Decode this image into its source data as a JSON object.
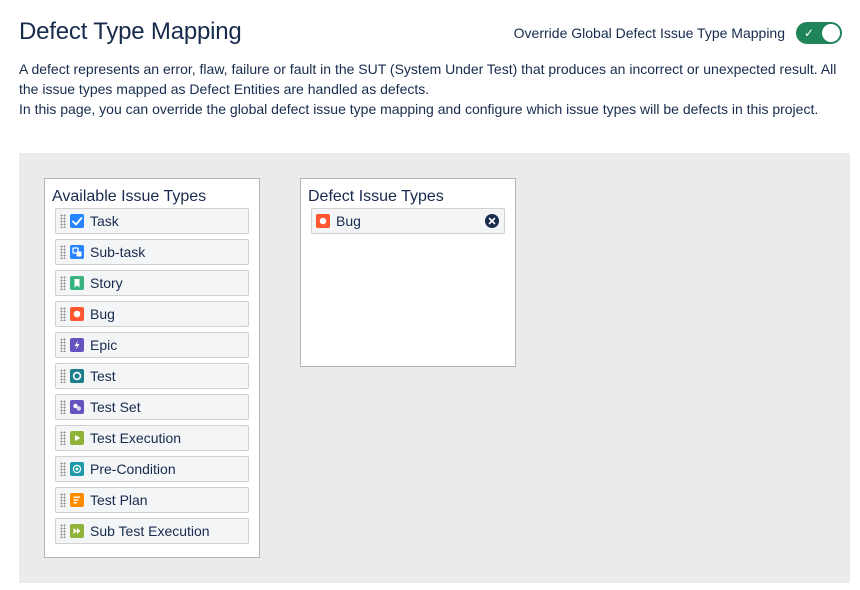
{
  "page": {
    "title": "Defect Type Mapping",
    "override_label": "Override Global Defect Issue Type Mapping",
    "override_enabled": true,
    "description_line1": "A defect represents an error, flaw, failure or fault in the SUT (System Under Test) that produces an incorrect or unexpected result. All the issue types mapped as Defect Entities are handled as defects.",
    "description_line2": "In this page, you can override the global defect issue type mapping and configure which issue types will be defects in this project."
  },
  "available": {
    "title": "Available Issue Types",
    "items": [
      {
        "label": "Task",
        "icon": "task-icon",
        "color": "#2684ff"
      },
      {
        "label": "Sub-task",
        "icon": "subtask-icon",
        "color": "#2684ff"
      },
      {
        "label": "Story",
        "icon": "story-icon",
        "color": "#36b37e"
      },
      {
        "label": "Bug",
        "icon": "bug-icon",
        "color": "#ff5630"
      },
      {
        "label": "Epic",
        "icon": "epic-icon",
        "color": "#6554c0"
      },
      {
        "label": "Test",
        "icon": "test-icon",
        "color": "#1d7f8c"
      },
      {
        "label": "Test Set",
        "icon": "test-set-icon",
        "color": "#6554c0"
      },
      {
        "label": "Test Execution",
        "icon": "test-execution-icon",
        "color": "#8fb339"
      },
      {
        "label": "Pre-Condition",
        "icon": "pre-condition-icon",
        "color": "#1d9aaa"
      },
      {
        "label": "Test Plan",
        "icon": "test-plan-icon",
        "color": "#ff8b00"
      },
      {
        "label": "Sub Test Execution",
        "icon": "sub-test-execution-icon",
        "color": "#8fb339"
      }
    ]
  },
  "defect": {
    "title": "Defect Issue Types",
    "items": [
      {
        "label": "Bug",
        "icon": "bug-icon",
        "color": "#ff5630"
      }
    ]
  }
}
